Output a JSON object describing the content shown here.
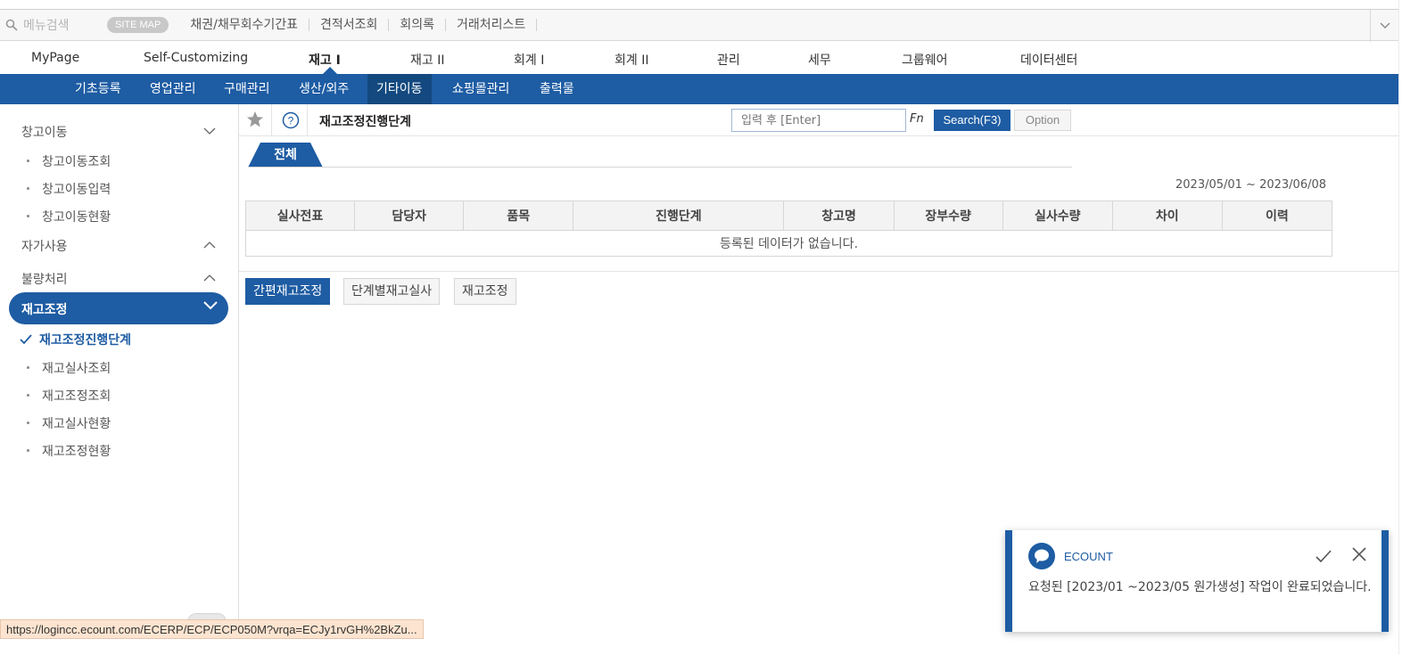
{
  "topbar": {
    "search_placeholder": "메뉴검색",
    "sitemap_label": "SITE MAP",
    "quick_links": [
      "채권/채무회수기간표",
      "견적서조회",
      "회의록",
      "거래처리스트"
    ]
  },
  "main_tabs": [
    {
      "label": "MyPage"
    },
    {
      "label": "Self-Customizing"
    },
    {
      "label": "재고 I"
    },
    {
      "label": "재고 II"
    },
    {
      "label": "회계 I"
    },
    {
      "label": "회계 II"
    },
    {
      "label": "관리"
    },
    {
      "label": "세무"
    },
    {
      "label": "그룹웨어"
    },
    {
      "label": "데이터센터"
    }
  ],
  "subnav": [
    {
      "label": "기초등록"
    },
    {
      "label": "영업관리"
    },
    {
      "label": "구매관리"
    },
    {
      "label": "생산/외주"
    },
    {
      "label": "기타이동"
    },
    {
      "label": "쇼핑몰관리"
    },
    {
      "label": "출력물"
    }
  ],
  "sidebar": {
    "groups": [
      {
        "label": "창고이동",
        "items": [
          "창고이동조회",
          "창고이동입력",
          "창고이동현황"
        ]
      },
      {
        "label": "자가사용"
      },
      {
        "label": "불량처리"
      },
      {
        "label": "재고조정",
        "items": [
          "재고조정진행단계",
          "재고실사조회",
          "재고조정조회",
          "재고실사현황",
          "재고조정현황"
        ]
      }
    ]
  },
  "page": {
    "title": "재고조정진행단계",
    "search_placeholder": "입력 후 [Enter]",
    "fn_label": "Fn",
    "search_button": "Search(F3)",
    "option_button": "Option",
    "tab_label": "전체",
    "date_range": "2023/05/01 ~ 2023/06/08"
  },
  "table": {
    "columns": [
      "실사전표",
      "담당자",
      "품목",
      "진행단계",
      "창고명",
      "장부수량",
      "실사수량",
      "차이",
      "이력"
    ],
    "empty_message": "등록된 데이터가 없습니다."
  },
  "bottom_buttons": [
    "간편재고조정",
    "단계별재고실사",
    "재고조정"
  ],
  "notification": {
    "title": "ECOUNT",
    "message": "요청된 [2023/01 ~2023/05 원가생성] 작업이 완료되었습니다."
  },
  "status_url": "https://logincc.ecount.com/ECERP/ECP/ECP050M?vrqa=ECJy1rvGH%2BkZu...",
  "colors": {
    "accent": "#1e5ca3",
    "accent_dark": "#13497f"
  }
}
